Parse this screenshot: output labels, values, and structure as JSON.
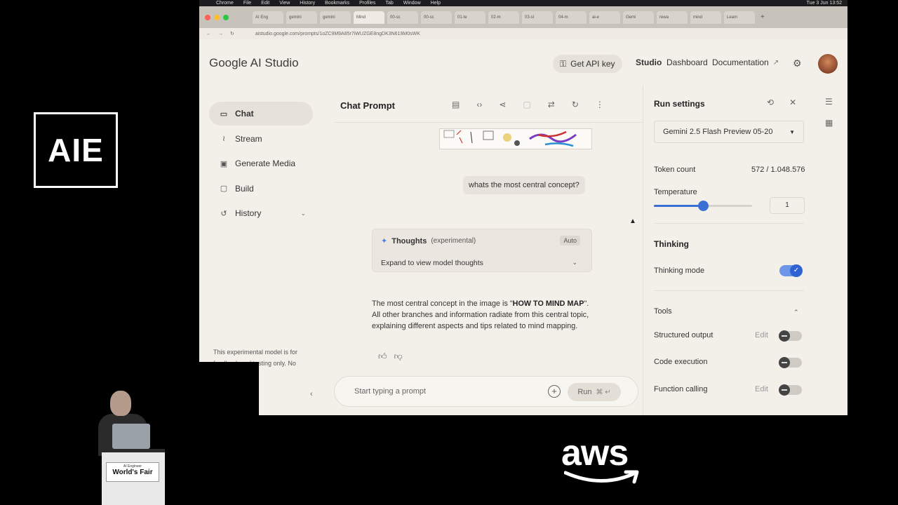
{
  "mac_menu": {
    "items": [
      "Chrome",
      "File",
      "Edit",
      "View",
      "History",
      "Bookmarks",
      "Profiles",
      "Tab",
      "Window",
      "Help"
    ],
    "clock": "Tue 3 Jun 13:52"
  },
  "browser": {
    "tabs": [
      "AI Eng",
      "gemini",
      "gemini",
      "Mind",
      "00-sc",
      "00-sc",
      "01-te",
      "02-m",
      "03-sl",
      "04-m",
      "ai-e",
      "Gemi",
      "rewa",
      "mind",
      "Learn"
    ],
    "url": "aistudio.google.com/prompts/1oZC9M9A85r7iWUZGE8ngDK3N619M0sWK"
  },
  "header": {
    "brand": "Google AI Studio",
    "get_api_key": "Get API key",
    "nav_studio": "Studio",
    "nav_dashboard": "Dashboard",
    "nav_documentation": "Documentation"
  },
  "sidebar": {
    "items": [
      {
        "label": "Chat",
        "icon": "chat-icon"
      },
      {
        "label": "Stream",
        "icon": "waveform-icon"
      },
      {
        "label": "Generate Media",
        "icon": "media-icon"
      },
      {
        "label": "Build",
        "icon": "build-icon"
      },
      {
        "label": "History",
        "icon": "history-icon"
      }
    ],
    "note": "This experimental model is for feedback and testing only. No"
  },
  "chat": {
    "title": "Chat Prompt",
    "user_message": "whats the most central concept?",
    "thoughts_label": "Thoughts",
    "thoughts_tag": "(experimental)",
    "thoughts_auto": "Auto",
    "thoughts_expand": "Expand to view model thoughts",
    "answer_pre": "The most central concept in the image is \"",
    "answer_bold": "HOW TO MIND MAP",
    "answer_post": "\". All other branches and information radiate from this central topic, explaining different aspects and tips related to mind mapping.",
    "prompt_placeholder": "Start typing a prompt",
    "run_label": "Run",
    "run_shortcut": "⌘ ↵"
  },
  "settings": {
    "title": "Run settings",
    "model": "Gemini 2.5 Flash Preview 05-20",
    "token_count_label": "Token count",
    "token_count_value": "572 / 1.048.576",
    "temperature_label": "Temperature",
    "temperature_value": "1",
    "temperature_fraction": 0.5,
    "thinking_header": "Thinking",
    "thinking_mode_label": "Thinking mode",
    "tools_header": "Tools",
    "structured_output": "Structured output",
    "code_execution": "Code execution",
    "function_calling": "Function calling",
    "edit_label": "Edit"
  },
  "stage": {
    "logo_text": "AIE",
    "sponsor": "aws",
    "lectern_small": "AI Engineer",
    "lectern_big": "World's Fair"
  },
  "colors": {
    "accent": "#3b6fd4",
    "page_bg": "#f3f0ea",
    "stage_bg": "#000000"
  }
}
